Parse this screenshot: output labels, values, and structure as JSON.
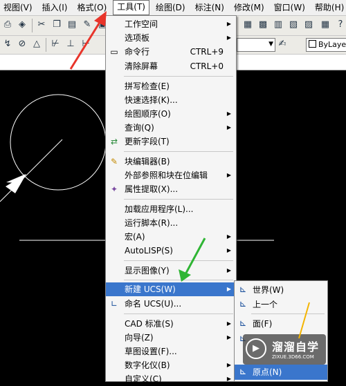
{
  "menubar": {
    "items": [
      {
        "label": "视图(V)"
      },
      {
        "label": "插入(I)"
      },
      {
        "label": "格式(O)"
      },
      {
        "label": "工具(T)",
        "active": true
      },
      {
        "label": "绘图(D)"
      },
      {
        "label": "标注(N)"
      },
      {
        "label": "修改(M)"
      },
      {
        "label": "窗口(W)"
      },
      {
        "label": "帮助(H)"
      }
    ]
  },
  "toolbar": {
    "layer_combo_value": "",
    "bylayer_label": "ByLayer"
  },
  "tools_menu": {
    "items": [
      {
        "label": "工作空间",
        "shortcut": "",
        "submenu": true
      },
      {
        "label": "选项板",
        "shortcut": "",
        "submenu": true
      },
      {
        "label": "命令行",
        "shortcut": "CTRL+9",
        "icon": "command-line-icon"
      },
      {
        "label": "清除屏幕",
        "shortcut": "CTRL+0"
      },
      {
        "label": "拼写检查(E)",
        "shortcut": ""
      },
      {
        "label": "快速选择(K)...",
        "shortcut": ""
      },
      {
        "label": "绘图顺序(O)",
        "shortcut": "",
        "submenu": true
      },
      {
        "label": "查询(Q)",
        "shortcut": "",
        "submenu": true
      },
      {
        "label": "更新字段(T)",
        "shortcut": "",
        "icon": "update-field-icon"
      },
      {
        "label": "块编辑器(B)",
        "shortcut": "",
        "icon": "block-editor-icon"
      },
      {
        "label": "外部参照和块在位编辑",
        "shortcut": "",
        "submenu": true
      },
      {
        "label": "属性提取(X)...",
        "shortcut": "",
        "icon": "attribute-extract-icon"
      },
      {
        "label": "加载应用程序(L)...",
        "shortcut": ""
      },
      {
        "label": "运行脚本(R)...",
        "shortcut": ""
      },
      {
        "label": "宏(A)",
        "shortcut": "",
        "submenu": true
      },
      {
        "label": "AutoLISP(S)",
        "shortcut": "",
        "submenu": true
      },
      {
        "label": "显示图像(Y)",
        "shortcut": "",
        "submenu": true
      },
      {
        "label": "新建 UCS(W)",
        "shortcut": "",
        "submenu": true,
        "highlighted": true
      },
      {
        "label": "命名 UCS(U)...",
        "shortcut": "",
        "icon": "named-ucs-icon"
      },
      {
        "label": "CAD 标准(S)",
        "shortcut": "",
        "submenu": true
      },
      {
        "label": "向导(Z)",
        "shortcut": "",
        "submenu": true
      },
      {
        "label": "草图设置(F)...",
        "shortcut": ""
      },
      {
        "label": "数字化仪(B)",
        "shortcut": "",
        "submenu": true
      },
      {
        "label": "自定义(C)",
        "shortcut": "",
        "submenu": true
      }
    ]
  },
  "ucs_submenu": {
    "items": [
      {
        "label": "世界(W)"
      },
      {
        "label": "上一个"
      },
      {
        "label": "面(F)"
      },
      {
        "label": ""
      },
      {
        "label": "原点(N)",
        "highlighted": true
      }
    ]
  },
  "watermark": {
    "title": "溜溜自学",
    "url": "ZIXUE.3D66.COM"
  },
  "colors": {
    "menu_highlight": "#3a76cc",
    "canvas_bg": "#000000",
    "red_arrow": "#e8342a",
    "green_arrow": "#2fb534",
    "yellow_arrow": "#f4b400"
  }
}
